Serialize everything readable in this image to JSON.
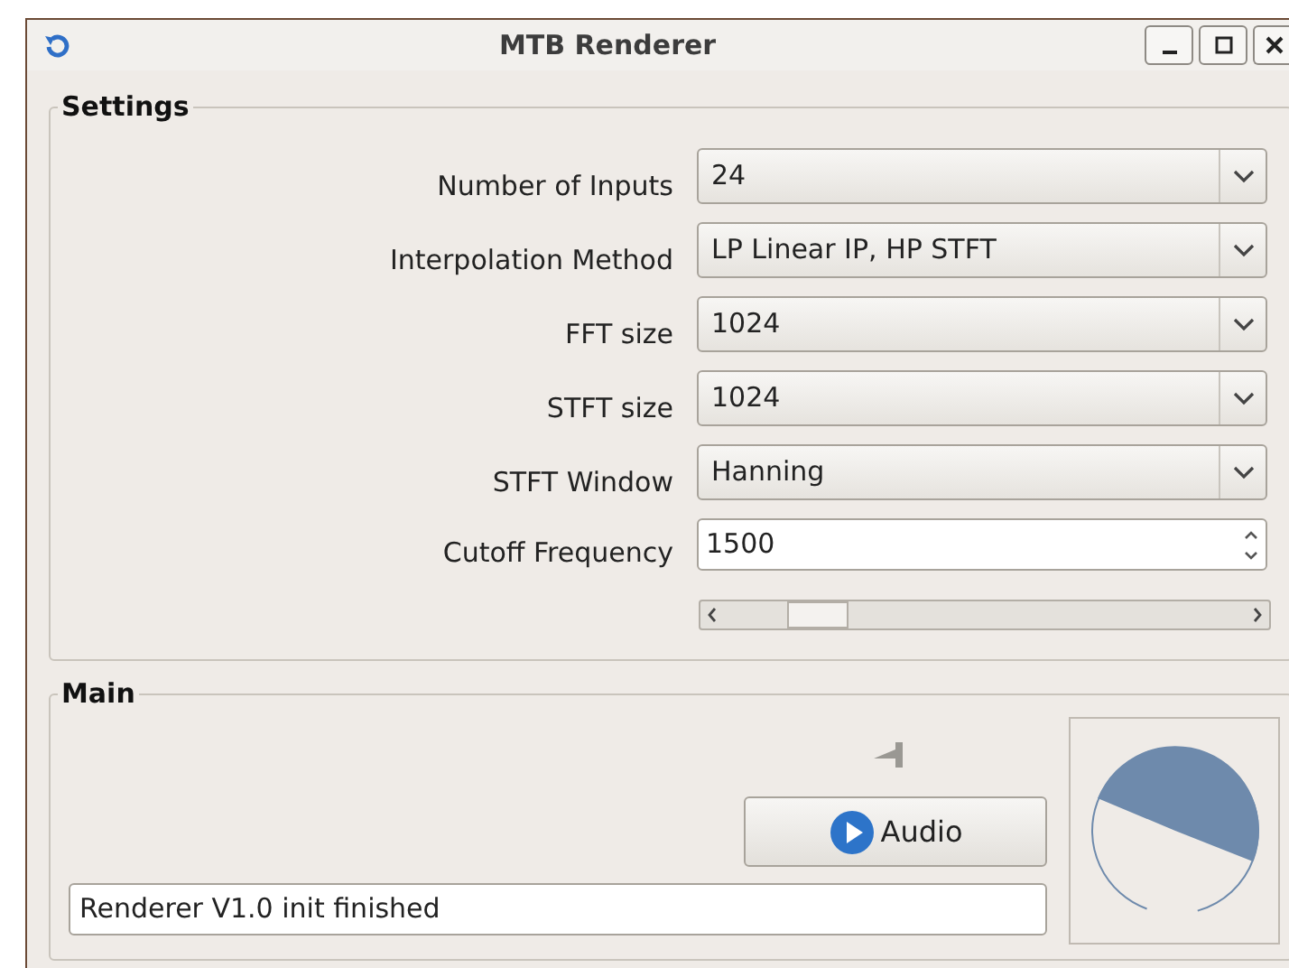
{
  "window": {
    "title": "MTB Renderer"
  },
  "settings": {
    "title": "Settings",
    "fields": [
      {
        "kind": "combo",
        "label": "Number of Inputs",
        "value": "24"
      },
      {
        "kind": "combo",
        "label": "Interpolation Method",
        "value": "LP Linear IP, HP STFT"
      },
      {
        "kind": "combo",
        "label": "FFT size",
        "value": "1024"
      },
      {
        "kind": "combo",
        "label": "STFT size",
        "value": "1024"
      },
      {
        "kind": "combo",
        "label": "STFT Window",
        "value": "Hanning"
      },
      {
        "kind": "spin",
        "label": "Cutoff Frequency",
        "value": "1500"
      }
    ]
  },
  "main": {
    "title": "Main",
    "audio_button": "Audio",
    "status": "Renderer V1.0 init finished"
  }
}
